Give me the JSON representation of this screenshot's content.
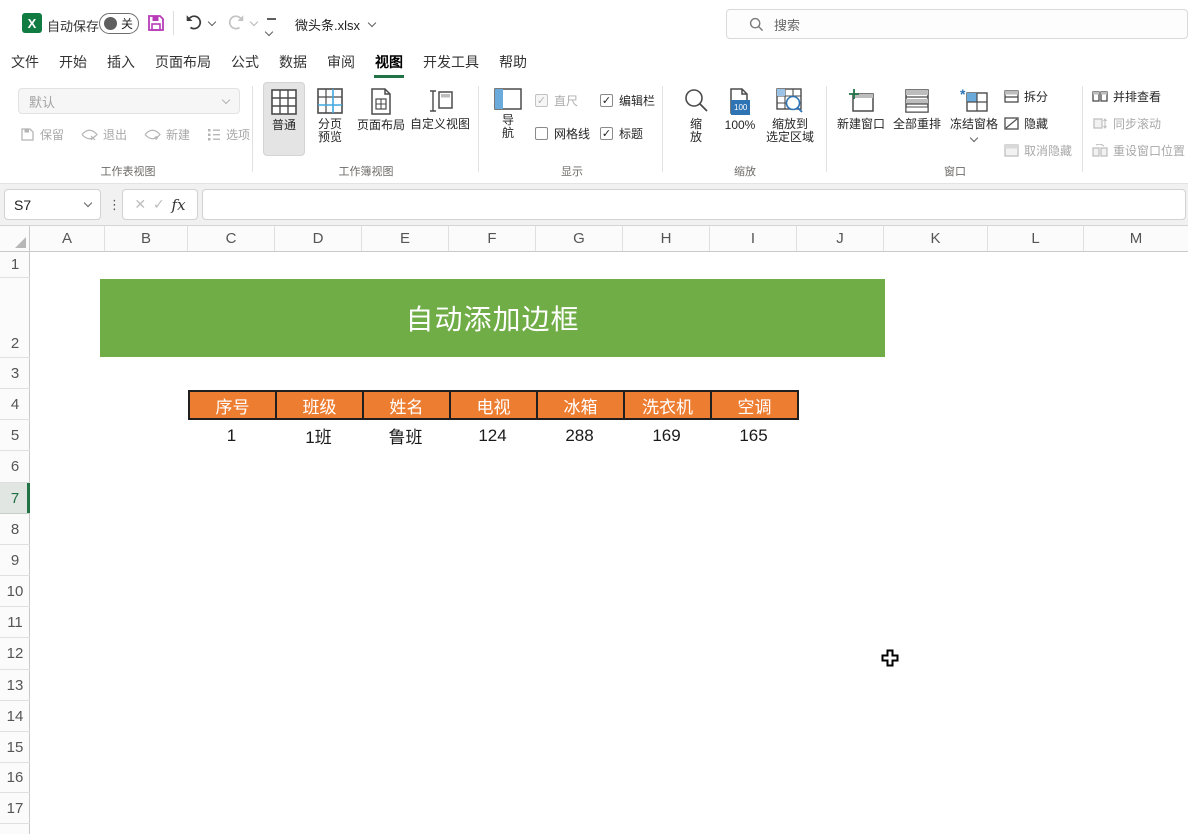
{
  "titlebar": {
    "autosave_label": "自动保存",
    "autosave_state": "关",
    "filename": "微头条.xlsx",
    "search_placeholder": "搜索"
  },
  "tabs": {
    "items": [
      "文件",
      "开始",
      "插入",
      "页面布局",
      "公式",
      "数据",
      "审阅",
      "视图",
      "开发工具",
      "帮助"
    ],
    "active": "视图"
  },
  "ribbon": {
    "sheet_view_group": {
      "label": "工作表视图",
      "view_selector_value": "默认",
      "keep": "保留",
      "exit": "退出",
      "new": "新建",
      "options": "选项"
    },
    "workbook_views_group": {
      "label": "工作簿视图",
      "normal": "普通",
      "page_break_line1": "分页",
      "page_break_line2": "预览",
      "page_layout": "页面布局",
      "custom_views": "自定义视图"
    },
    "show_group": {
      "label": "显示",
      "navigation_line1": "导",
      "navigation_line2": "航",
      "ruler": "直尺",
      "gridlines": "网格线",
      "formula_bar": "编辑栏",
      "headings": "标题",
      "ruler_checked": true,
      "gridlines_checked": false,
      "formula_bar_checked": true,
      "headings_checked": true
    },
    "zoom_group": {
      "label": "缩放",
      "zoom_line1": "缩",
      "zoom_line2": "放",
      "hundred": "100%",
      "hundred_badge": "100",
      "zoom_sel_line1": "缩放到",
      "zoom_sel_line2": "选定区域"
    },
    "window_group": {
      "label": "窗口",
      "new_window": "新建窗口",
      "arrange_all": "全部重排",
      "freeze_panes": "冻结窗格",
      "split": "拆分",
      "hide": "隐藏",
      "unhide": "取消隐藏"
    },
    "side_group": {
      "view_side_by_side": "并排查看",
      "sync_scroll": "同步滚动",
      "reset_position": "重设窗口位置"
    }
  },
  "formula_bar": {
    "name_box": "S7",
    "cancel": "✕",
    "enter": "✓",
    "fx": "fx"
  },
  "grid": {
    "columns": [
      "A",
      "B",
      "C",
      "D",
      "E",
      "F",
      "G",
      "H",
      "I",
      "J",
      "K",
      "L",
      "M"
    ],
    "rows": [
      "1",
      "2",
      "3",
      "4",
      "5",
      "6",
      "7",
      "8",
      "9",
      "10",
      "11",
      "12",
      "13",
      "14",
      "15",
      "16",
      "17"
    ],
    "selected_cell": "S7",
    "selected_row": "7"
  },
  "sheet": {
    "banner": {
      "text": "自动添加边框",
      "bg": "#70AD47"
    },
    "table": {
      "headers": [
        "序号",
        "班级",
        "姓名",
        "电视",
        "冰箱",
        "洗衣机",
        "空调"
      ],
      "values": [
        "1",
        "1班",
        "鲁班",
        "124",
        "288",
        "169",
        "165"
      ],
      "header_bg": "#ED7D31",
      "header_text": "#FFFFFF",
      "border_color": "#1F1F1F"
    }
  },
  "colors": {
    "accent_green": "#217346",
    "banner_green": "#70AD47",
    "table_orange": "#ED7D31",
    "save_icon": "#B83BB8"
  }
}
